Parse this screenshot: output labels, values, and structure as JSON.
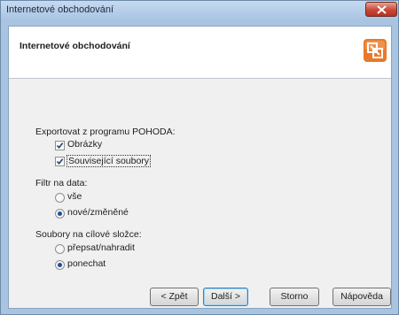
{
  "window": {
    "title": "Internetové obchodování"
  },
  "header": {
    "title": "Internetové obchodování"
  },
  "export": {
    "label": "Exportovat z programu POHODA:",
    "options": [
      {
        "label": "Obrázky",
        "checked": true
      },
      {
        "label": "Související soubory",
        "checked": true
      }
    ]
  },
  "filter": {
    "label": "Filtr na data:",
    "options": [
      {
        "label": "vše",
        "selected": false
      },
      {
        "label": "nové/změněné",
        "selected": true
      }
    ]
  },
  "files": {
    "label": "Soubory na cílové složce:",
    "options": [
      {
        "label": "přepsat/nahradit",
        "selected": false
      },
      {
        "label": "ponechat",
        "selected": true
      }
    ]
  },
  "buttons": {
    "back": "< Zpět",
    "next": "Další >",
    "cancel": "Storno",
    "help": "Nápověda"
  },
  "icons": {
    "close": "close-icon",
    "logo": "pohoda-logo-icon",
    "check": "checkmark-icon"
  },
  "colors": {
    "title_bar": "#a8c4e4",
    "close": "#c8483a",
    "logo": "#e8792a"
  }
}
